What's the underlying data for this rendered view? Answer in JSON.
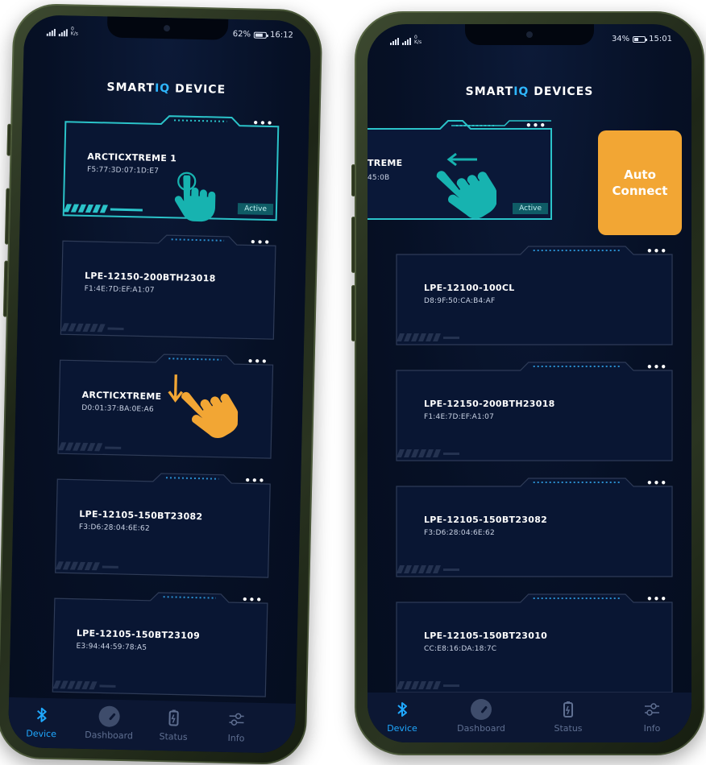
{
  "colors": {
    "screen_bg": "#071026",
    "card_border": "#2e3b57",
    "card_active_border": "#2bc3c9",
    "accent_blue": "#2fb7ff",
    "auto_connect": "#f2a634",
    "hand_teal": "#17b3b0",
    "hand_orange": "#f2a634"
  },
  "left_phone": {
    "status": {
      "left_small": "0\nK/s",
      "battery": "62%",
      "time": "16:12"
    },
    "title_prefix": "SMART",
    "title_iq": "IQ",
    "title_suffix": " DEVICE",
    "devices": [
      {
        "name": "ARCTICXTREME 1",
        "mac": "F5:77:3D:07:1D:E7",
        "active": true,
        "badge": "Active"
      },
      {
        "name": "LPE-12150-200BTH23018",
        "mac": "F1:4E:7D:EF:A1:07",
        "active": false
      },
      {
        "name": "ARCTICXTREME",
        "mac": "D0:01:37:BA:0E:A6",
        "active": false
      },
      {
        "name": "LPE-12105-150BT23082",
        "mac": "F3:D6:28:04:6E:62",
        "active": false
      },
      {
        "name": "LPE-12105-150BT23109",
        "mac": "E3:94:44:59:78:A5",
        "active": false
      }
    ],
    "more_icon": "•••",
    "nav": [
      {
        "label": "Device",
        "icon": "bluetooth-icon",
        "active": true
      },
      {
        "label": "Dashboard",
        "icon": "gauge-icon",
        "active": false
      },
      {
        "label": "Status",
        "icon": "battery-icon",
        "active": false
      },
      {
        "label": "Info",
        "icon": "sliders-icon",
        "active": false
      }
    ]
  },
  "right_phone": {
    "status": {
      "left_small": "0\nK/s",
      "battery": "34%",
      "time": "15:01"
    },
    "title_prefix": "SMART",
    "title_iq": "IQ",
    "title_suffix": " DEVICES",
    "active_device": {
      "name_partial": "TREME",
      "mac_partial": "45:0B",
      "badge": "Active"
    },
    "auto_connect": {
      "line1": "Auto",
      "line2": "Connect"
    },
    "devices": [
      {
        "name": "LPE-12100-100CL",
        "mac": "D8:9F:50:CA:B4:AF"
      },
      {
        "name": "LPE-12150-200BTH23018",
        "mac": "F1:4E:7D:EF:A1:07"
      },
      {
        "name": "LPE-12105-150BT23082",
        "mac": "F3:D6:28:04:6E:62"
      },
      {
        "name": "LPE-12105-150BT23010",
        "mac": "CC:E8:16:DA:18:7C"
      }
    ],
    "more_icon": "•••",
    "nav": [
      {
        "label": "Device",
        "icon": "bluetooth-icon",
        "active": true
      },
      {
        "label": "Dashboard",
        "icon": "gauge-icon",
        "active": false
      },
      {
        "label": "Status",
        "icon": "battery-icon",
        "active": false
      },
      {
        "label": "Info",
        "icon": "sliders-icon",
        "active": false
      }
    ]
  }
}
